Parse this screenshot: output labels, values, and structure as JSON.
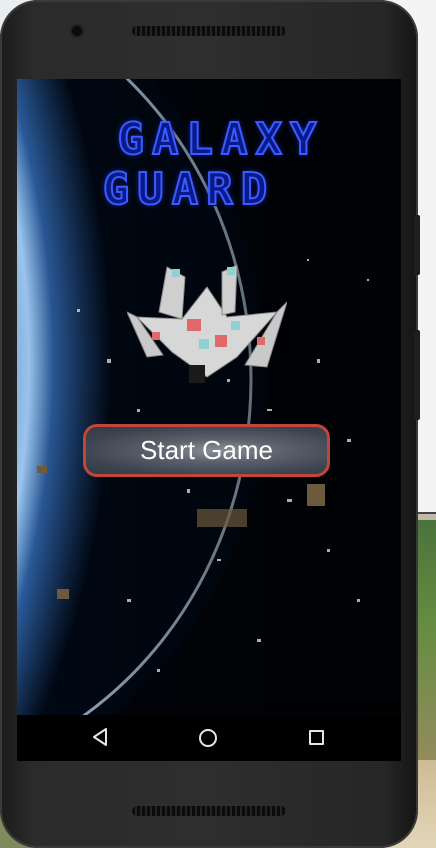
{
  "game": {
    "title_line1": "GALAXY",
    "title_line2": "GUARD",
    "start_button_label": "Start Game"
  },
  "nav": {
    "back_icon": "back-triangle-icon",
    "home_icon": "home-circle-icon",
    "recents_icon": "recents-square-icon"
  },
  "colors": {
    "title": "#0a1a8a",
    "title_glow": "#3a5cff",
    "button_border": "#c2453a",
    "button_fill": "#3c434e"
  }
}
